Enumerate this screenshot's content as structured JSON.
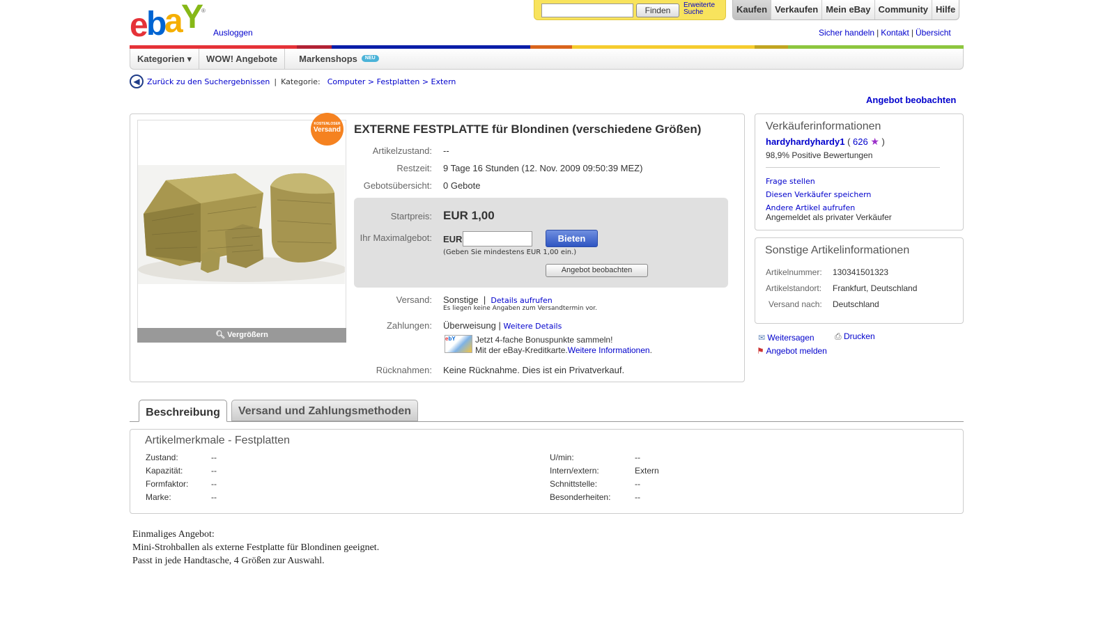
{
  "header": {
    "logout": "Ausloggen",
    "search": {
      "value": "",
      "find_label": "Finden",
      "advanced_line1": "Erweiterte",
      "advanced_line2": "Suche"
    },
    "topnav": [
      "Kaufen",
      "Verkaufen",
      "Mein eBay",
      "Community",
      "Hilfe"
    ],
    "toplinks": [
      "Sicher handeln",
      "Kontakt",
      "Übersicht"
    ],
    "catbar": {
      "categories": "Kategorien ▾",
      "wow": "WOW! Angebote",
      "brands": "Markenshops",
      "neu": "NEU"
    }
  },
  "breadcrumb": {
    "back": "Zurück zu den Suchergebnissen",
    "category_label": "Kategorie:",
    "path": "Computer > Festplatten > Extern"
  },
  "watch_top": "Angebot beobachten",
  "item": {
    "free_shipping_small": "KOSTENLOSER",
    "free_shipping_big": "Versand",
    "zoom": "Vergrößern",
    "title": "EXTERNE FESTPLATTE für Blondinen (verschiedene Größen)",
    "condition_label": "Artikelzustand:",
    "condition_value": "--",
    "time_label": "Restzeit:",
    "time_value": "9 Tage 16 Stunden (12. Nov. 2009 09:50:39 MEZ)",
    "bids_label": "Gebotsübersicht:",
    "bids_value": "0 Gebote",
    "start_label": "Startpreis:",
    "start_value": "EUR 1,00",
    "maxbid_label": "Ihr Maximalgebot:",
    "currency": "EUR",
    "bid_button": "Bieten",
    "min_hint": "(Geben Sie mindestens EUR 1,00 ein.)",
    "watch_button": "Angebot beobachten",
    "shipping_label": "Versand:",
    "shipping_value": "Sonstige",
    "shipping_link": "Details aufrufen",
    "shipping_note": "Es liegen keine Angaben zum Versandtermin vor.",
    "payment_label": "Zahlungen:",
    "payment_value": "Überweisung",
    "payment_link": "Weitere Details",
    "card_line1": "Jetzt 4-fache Bonuspunkte sammeln!",
    "card_line2": "Mit der eBay-Kreditkarte.",
    "card_link": "Weitere Informationen",
    "returns_label": "Rücknahmen:",
    "returns_value": "Keine Rücknahme. Dies ist ein Privatverkauf."
  },
  "seller": {
    "heading": "Verkäuferinformationen",
    "name": "hardyhardyhardy1",
    "score": "626",
    "positive": "98,9% Positive Bewertungen",
    "ask": "Frage stellen",
    "save": "Diesen Verkäufer speichern",
    "other": "Andere Artikel aufrufen",
    "type": "Angemeldet als privater Verkäufer"
  },
  "otherinfo": {
    "heading": "Sonstige Artikelinformationen",
    "number_label": "Artikelnummer:",
    "number_value": "130341501323",
    "location_label": "Artikelstandort:",
    "location_value": "Frankfurt, Deutschland",
    "shipto_label": "Versand nach:",
    "shipto_value": "Deutschland"
  },
  "actions": {
    "share": "Weitersagen",
    "print": "Drucken",
    "report": "Angebot melden"
  },
  "tabs": [
    "Beschreibung",
    "Versand und Zahlungsmethoden"
  ],
  "features": {
    "heading": "Artikelmerkmale - Festplatten",
    "left": [
      {
        "k": "Zustand:",
        "v": "--"
      },
      {
        "k": "Kapazität:",
        "v": "--"
      },
      {
        "k": "Formfaktor:",
        "v": "--"
      },
      {
        "k": "Marke:",
        "v": "--"
      }
    ],
    "right": [
      {
        "k": "U/min:",
        "v": "--"
      },
      {
        "k": "Intern/extern:",
        "v": "Extern"
      },
      {
        "k": "Schnittstelle:",
        "v": "--"
      },
      {
        "k": "Besonderheiten:",
        "v": "--"
      }
    ]
  },
  "description": [
    "Einmaliges Angebot:",
    "Mini-Strohballen als externe Festplatte für Blondinen geeignet.",
    "Passt in jede Handtasche, 4 Größen zur Auswahl."
  ],
  "colors": {
    "ebay_red": "#e53238",
    "ebay_blue": "#0064d2",
    "ebay_yellow": "#f5af02",
    "ebay_green": "#86b817",
    "link": "#0000cc"
  }
}
